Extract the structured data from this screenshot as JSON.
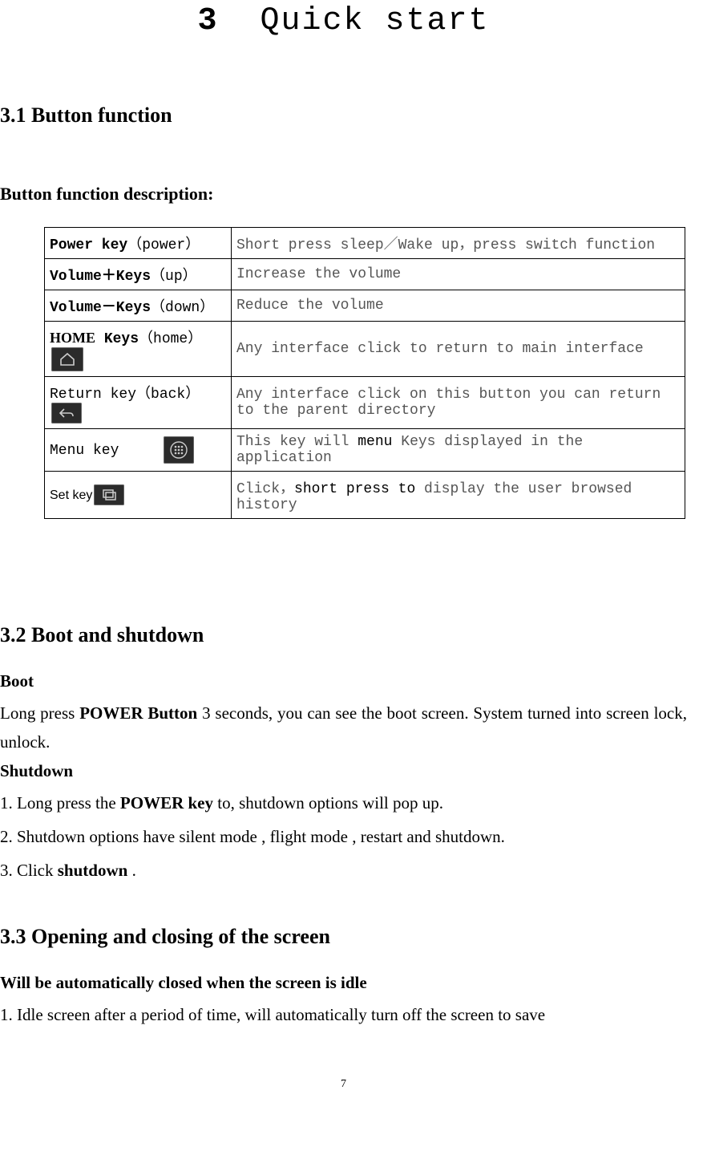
{
  "chapter": {
    "number": "3",
    "title": "Quick start"
  },
  "sections": {
    "s31": {
      "heading": "3.1 Button function",
      "sub": "Button function description:"
    },
    "table": {
      "rows": [
        {
          "label_bold": "Power key",
          "label_paren": "（power）",
          "desc": "Short press sleep／Wake up，press switch function"
        },
        {
          "label_bold": "Volume＋Keys",
          "label_paren": "（up）",
          "desc": "Increase the volume"
        },
        {
          "label_bold": "Volume－Keys",
          "label_paren": "（down）",
          "desc": "Reduce the volume"
        },
        {
          "label_bold_serif": "HOME",
          "label_bold_mono": "Keys",
          "label_paren": "（home）",
          "desc": "Any interface click to return to main interface",
          "icon": "home"
        },
        {
          "label_plain": "Return key",
          "label_paren": "（back）",
          "desc": "Any interface click on this button you can return to the parent directory",
          "icon_inline": "back"
        },
        {
          "label_plain": "Menu key",
          "desc_pre": "This key will",
          "desc_bold": "menu",
          "desc_post": "Keys displayed in the application",
          "icon_inline": "menu"
        },
        {
          "label_plain_sans": "Set key",
          "desc_pre": "Click，",
          "desc_bold": "short press to",
          "desc_post": " display the user browsed history",
          "icon_inline": "recent"
        }
      ]
    },
    "s32": {
      "heading": "3.2 Boot and shutdown",
      "boot_h": "Boot",
      "boot_p1a": "Long press ",
      "boot_p1b": "POWER Button",
      "boot_p1c": " 3 seconds, you can see the boot screen. System turned into screen lock, unlock.",
      "shut_h": "Shutdown",
      "shut_l1a": "1. Long press the ",
      "shut_l1b": "POWER key",
      "shut_l1c": " to, shutdown options will pop up.",
      "shut_l2": "2. Shutdown options have silent mode , flight mode , restart and shutdown.",
      "shut_l3a": "3. Click ",
      "shut_l3b": "shutdown",
      "shut_l3c": " ."
    },
    "s33": {
      "heading": "3.3 Opening and closing of the screen",
      "sub": "Will be automatically closed when the screen is idle",
      "p1": "1. Idle screen after a period of time, will automatically turn off the screen to save"
    }
  },
  "page_number": "7"
}
